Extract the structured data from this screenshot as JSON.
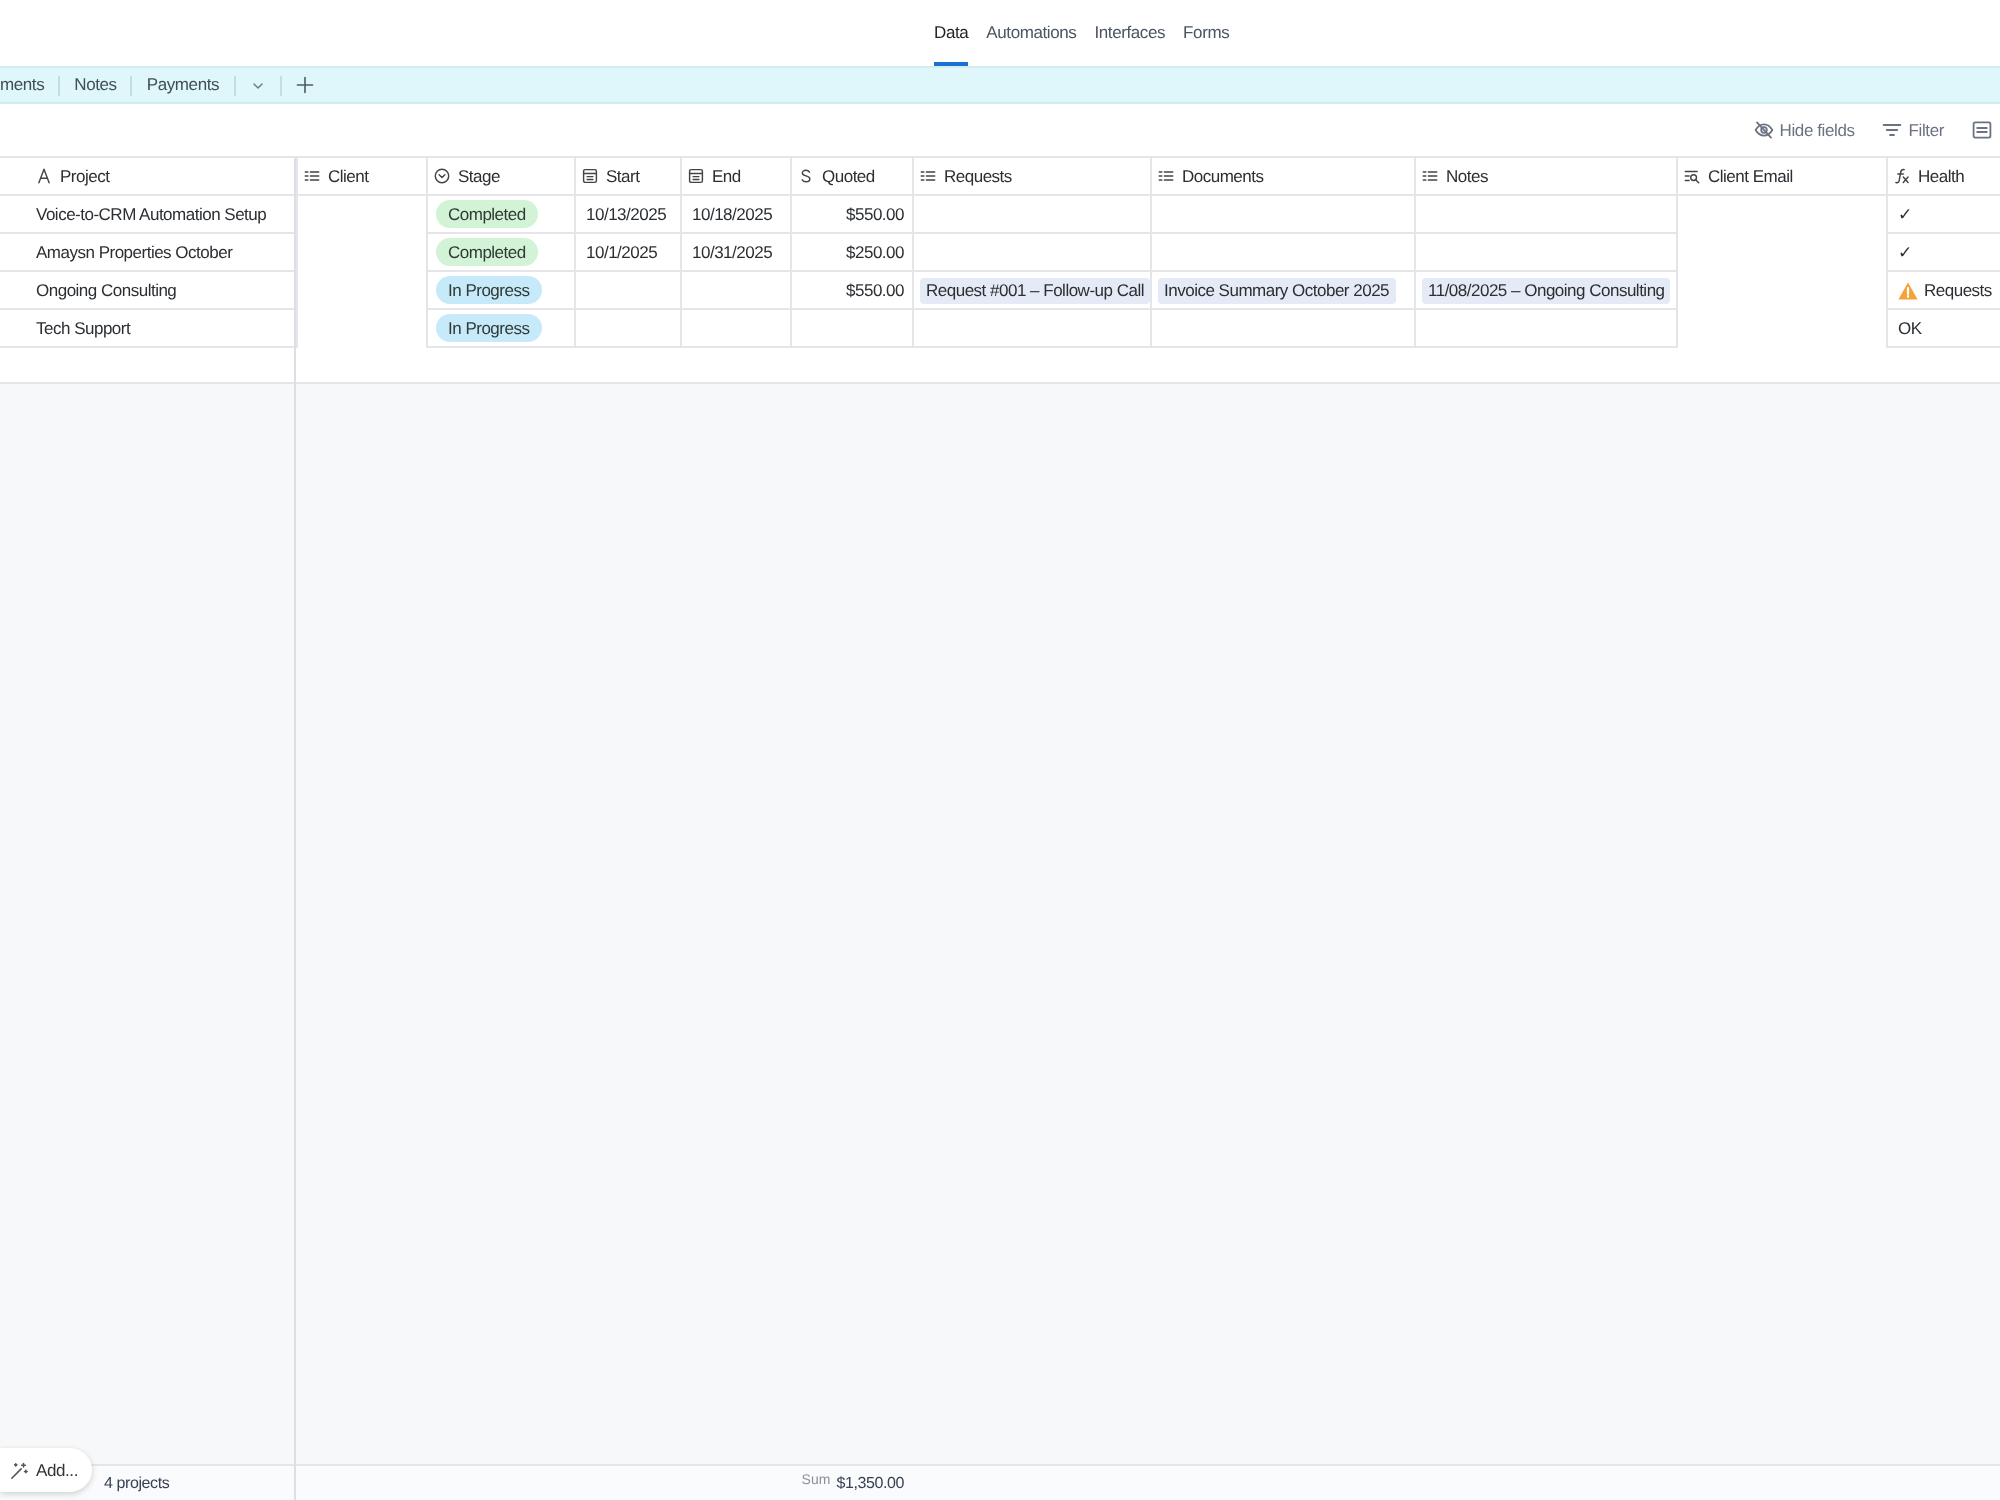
{
  "top_tabs": [
    {
      "label": "Data",
      "selected": true
    },
    {
      "label": "Automations",
      "selected": false
    },
    {
      "label": "Interfaces",
      "selected": false
    },
    {
      "label": "Forms",
      "selected": false
    }
  ],
  "table_tabs": [
    {
      "label": "ments",
      "selected": false
    },
    {
      "label": "Notes",
      "selected": false
    },
    {
      "label": "Payments",
      "selected": false
    }
  ],
  "toolbar": [
    {
      "kind": "hide",
      "label": "Hide fields"
    },
    {
      "kind": "filter",
      "label": "Filter"
    },
    {
      "kind": "panel"
    }
  ],
  "table": {
    "columns": [
      {
        "kind": "text",
        "label": "Project"
      },
      {
        "kind": "link",
        "label": "Client"
      },
      {
        "kind": "select",
        "label": "Stage"
      },
      {
        "kind": "date",
        "label": "Start"
      },
      {
        "kind": "date",
        "label": "End"
      },
      {
        "kind": "currency",
        "label": "Quoted"
      },
      {
        "kind": "link",
        "label": "Requests"
      },
      {
        "kind": "link",
        "label": "Documents"
      },
      {
        "kind": "link",
        "label": "Notes"
      },
      {
        "kind": "lookup",
        "label": "Client Email"
      },
      {
        "kind": "formula",
        "label": "Health"
      }
    ],
    "rows": [
      {
        "project": "Voice-to-CRM Automation Setup",
        "stage": {
          "label": "Completed",
          "color": "#d2f3d6"
        },
        "start": "10/13/2025",
        "end": "10/18/2025",
        "quoted": "$550.00",
        "health": {
          "text": "✓",
          "warning": false
        }
      },
      {
        "project": "Amaysn Properties October",
        "stage": {
          "label": "Completed",
          "color": "#d2f3d6"
        },
        "start": "10/1/2025",
        "end": "10/31/2025",
        "quoted": "$250.00",
        "health": {
          "text": "✓",
          "warning": false
        }
      },
      {
        "project": "Ongoing Consulting",
        "stage": {
          "label": "In Progress",
          "color": "#c6eafa"
        },
        "quoted": "$550.00",
        "requests": "Request #001 – Follow-up Call",
        "documents": "Invoice Summary October 2025",
        "notes": "11/08/2025 – Ongoing Consulting",
        "health": {
          "text": "Requests",
          "warning": true
        }
      },
      {
        "project": "Tech Support",
        "stage": {
          "label": "In Progress",
          "color": "#c6eafa"
        },
        "health": {
          "text": "OK",
          "warning": false
        }
      }
    ]
  },
  "footer": {
    "count": "4 projects",
    "sum_label": "Sum",
    "sum_value": "$1,350.00"
  },
  "add_button": {
    "label": "Add..."
  }
}
